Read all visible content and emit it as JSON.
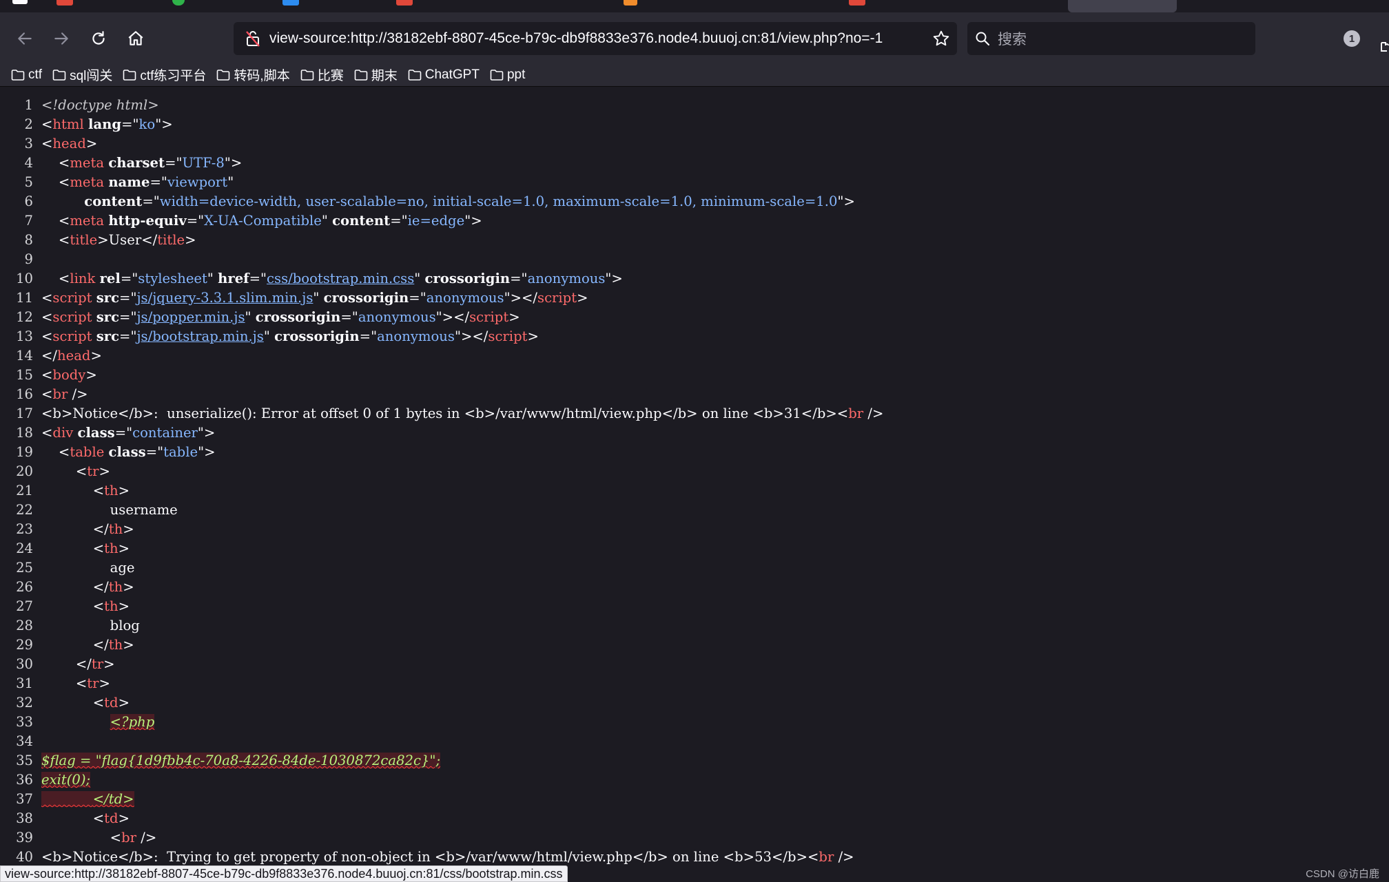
{
  "navbar": {
    "url": "view-source:http://38182ebf-8807-45ce-b79c-db9f8833e376.node4.buuoj.cn:81/view.php?no=-1",
    "search_placeholder": "搜索",
    "extension_badge": "1"
  },
  "bookmarks": [
    "ctf",
    "sql闯关",
    "ctf练习平台",
    "转码,脚本",
    "比赛",
    "期末",
    "ChatGPT",
    "ppt"
  ],
  "source": {
    "line_numbers": [
      "1",
      "2",
      "3",
      "4",
      "5",
      "6",
      "7",
      "8",
      "9",
      "10",
      "11",
      "12",
      "13",
      "14",
      "15",
      "16",
      "17",
      "18",
      "19",
      "20",
      "21",
      "22",
      "23",
      "24",
      "25",
      "26",
      "27",
      "28",
      "29",
      "30",
      "31",
      "32",
      "33",
      "34",
      "35",
      "36",
      "37",
      "38",
      "39",
      "40"
    ],
    "doctype": "<!doctype html>",
    "l2": {
      "tag": "html",
      "attr": "lang",
      "val": "ko"
    },
    "l3": "head",
    "l4": {
      "tag": "meta",
      "attr": "charset",
      "val": "UTF-8"
    },
    "l5": {
      "tag": "meta",
      "attr": "name",
      "val": "viewport"
    },
    "l6": {
      "attr": "content",
      "val": "width=device-width, user-scalable=no, initial-scale=1.0, maximum-scale=1.0, minimum-scale=1.0"
    },
    "l7": {
      "tag": "meta",
      "attr1": "http-equiv",
      "val1": "X-UA-Compatible",
      "attr2": "content",
      "val2": "ie=edge"
    },
    "l8": {
      "tag": "title",
      "text": "User"
    },
    "l10": {
      "tag": "link",
      "attr1": "rel",
      "val1": "stylesheet",
      "attr2": "href",
      "val2": "css/bootstrap.min.css",
      "attr3": "crossorigin",
      "val3": "anonymous"
    },
    "l11": {
      "tag": "script",
      "attr1": "src",
      "val1": "js/jquery-3.3.1.slim.min.js",
      "attr2": "crossorigin",
      "val2": "anonymous"
    },
    "l12": {
      "tag": "script",
      "attr1": "src",
      "val1": "js/popper.min.js",
      "attr2": "crossorigin",
      "val2": "anonymous"
    },
    "l13": {
      "tag": "script",
      "attr1": "src",
      "val1": "js/bootstrap.min.js",
      "attr2": "crossorigin",
      "val2": "anonymous"
    },
    "l14": "head",
    "l15": "body",
    "l16": "br",
    "l17": {
      "b": "b",
      "notice": "Notice",
      "msg": ":  unserialize(): Error at offset 0 of 1 bytes in ",
      "path": "/var/www/html/view.php",
      "on": " on line ",
      "num": "31"
    },
    "l18": {
      "tag": "div",
      "attr": "class",
      "val": "container"
    },
    "l19": {
      "tag": "table",
      "attr": "class",
      "val": "table"
    },
    "tr": "tr",
    "th": "th",
    "td": "td",
    "headers": [
      "username",
      "age",
      "blog"
    ],
    "php_open": "<?php",
    "flag_line": "$flag = \"flag{1d9fbb4c-70a8-4226-84de-1030872ca82c}\";",
    "exit_line": "exit(0);",
    "td_close": "</td>",
    "l40": {
      "notice": "Notice",
      "msg": ":  Trying to get property of non-object in ",
      "path": "/var/www/html/view.php",
      "on": " on line ",
      "num": "53"
    }
  },
  "status_bar": "view-source:http://38182ebf-8807-45ce-b79c-db9f8833e376.node4.buuoj.cn:81/css/bootstrap.min.css",
  "watermark": "CSDN @访白鹿"
}
